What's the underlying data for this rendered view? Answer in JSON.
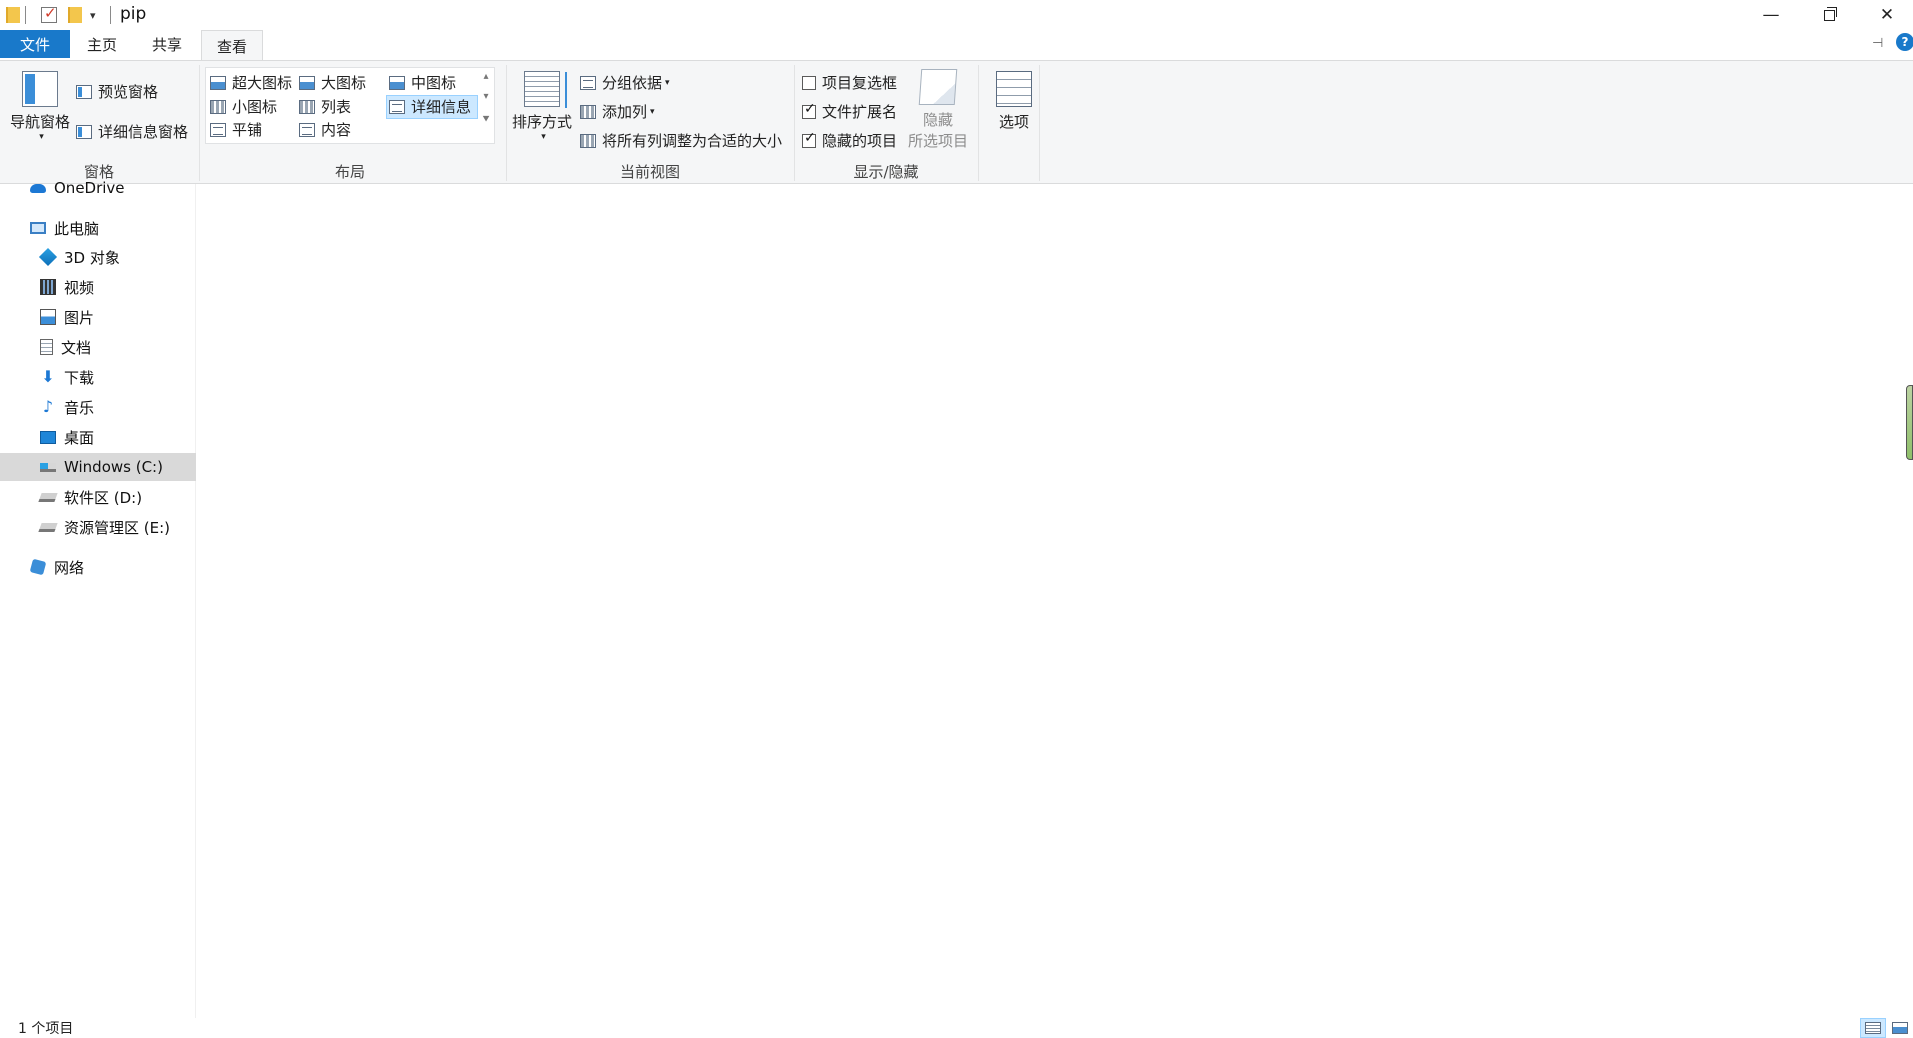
{
  "window": {
    "title": "pip",
    "controls": {
      "minimize": "—",
      "close": "✕"
    }
  },
  "tabs": [
    {
      "label": "文件",
      "active": false,
      "accent": "#1979ca"
    },
    {
      "label": "主页"
    },
    {
      "label": "共享"
    },
    {
      "label": "查看",
      "active": true
    }
  ],
  "ribbon": {
    "panes": {
      "nav_pane": "导航窗格",
      "preview_pane": "预览窗格",
      "details_pane": "详细信息窗格",
      "group_label": "窗格"
    },
    "layout": {
      "items": [
        "超大图标",
        "大图标",
        "中图标",
        "小图标",
        "列表",
        "详细信息",
        "平铺",
        "内容"
      ],
      "selected": "详细信息",
      "group_label": "布局"
    },
    "current_view": {
      "sort_by": "排序方式",
      "group_by": "分组依据",
      "add_columns": "添加列",
      "size_all_columns": "将所有列调整为合适的大小",
      "group_label": "当前视图"
    },
    "show_hide": {
      "item_checkboxes": {
        "label": "项目复选框",
        "checked": false
      },
      "file_extensions": {
        "label": "文件扩展名",
        "checked": true
      },
      "hidden_items": {
        "label": "隐藏的项目",
        "checked": true
      },
      "hide_selected_line1": "隐藏",
      "hide_selected_line2": "所选项目",
      "group_label": "显示/隐藏"
    },
    "options": "选项"
  },
  "navigation": {
    "items": [
      {
        "label": "OneDrive",
        "icon": "cloud-icon"
      },
      {
        "label": "此电脑",
        "icon": "pc-icon"
      },
      {
        "label": "3D 对象",
        "icon": "3d-objects-icon"
      },
      {
        "label": "视频",
        "icon": "video-icon"
      },
      {
        "label": "图片",
        "icon": "pictures-icon"
      },
      {
        "label": "文档",
        "icon": "documents-icon"
      },
      {
        "label": "下载",
        "icon": "download-icon"
      },
      {
        "label": "音乐",
        "icon": "music-icon"
      },
      {
        "label": "桌面",
        "icon": "desktop-icon"
      },
      {
        "label": "Windows (C:)",
        "icon": "windows-drive-icon",
        "selected": true
      },
      {
        "label": "软件区 (D:)",
        "icon": "drive-icon"
      },
      {
        "label": "资源管理区 (E:)",
        "icon": "drive-icon"
      },
      {
        "label": "网络",
        "icon": "network-icon"
      }
    ]
  },
  "status": {
    "item_count": "1 个项目"
  }
}
